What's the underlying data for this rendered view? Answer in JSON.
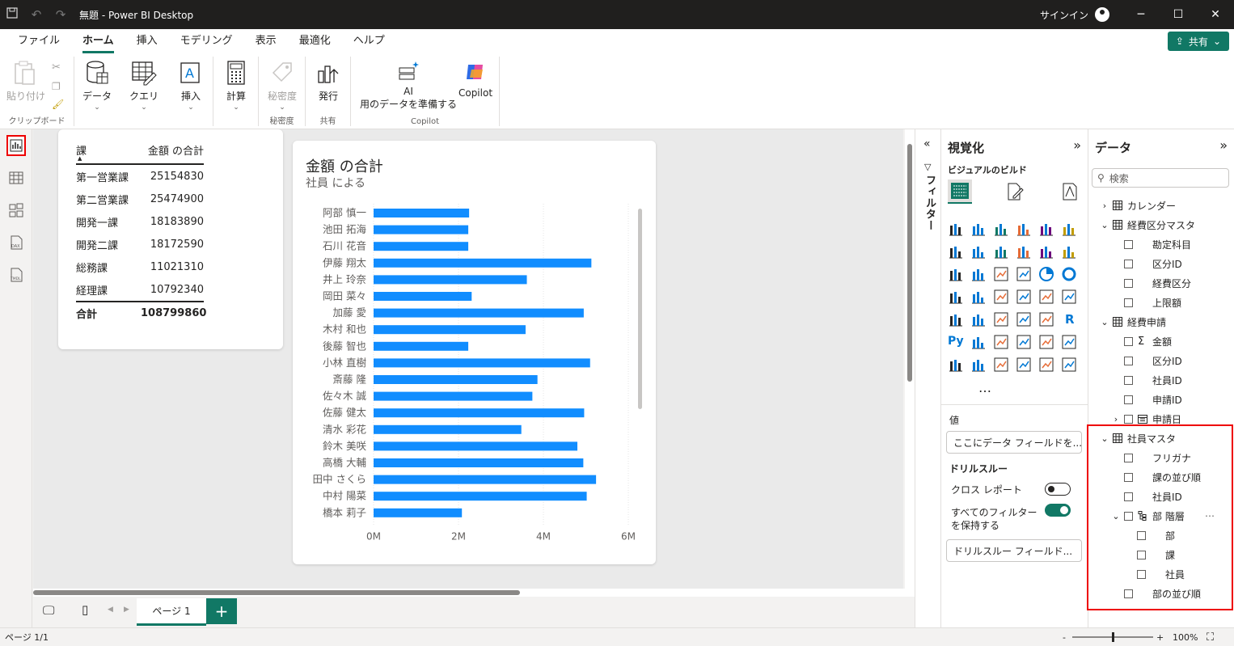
{
  "window": {
    "title": "無題 - Power BI Desktop",
    "signin": "サインイン"
  },
  "menu": [
    "ファイル",
    "ホーム",
    "挿入",
    "モデリング",
    "表示",
    "最適化",
    "ヘルプ"
  ],
  "share_label": "共有",
  "ribbon": {
    "paste": "貼り付け",
    "data": "データ",
    "query": "クエリ",
    "insert": "挿入",
    "calc": "計算",
    "sensitivity": "秘密度",
    "publish": "発行",
    "ai_line1": "AI",
    "ai_line2": "用のデータを準備する",
    "copilot": "Copilot",
    "groups": {
      "clipboard": "クリップボード",
      "sensitivity": "秘密度",
      "share": "共有",
      "copilot": "Copilot"
    }
  },
  "table_visual": {
    "headers": [
      "課",
      "金額 の合計"
    ],
    "rows": [
      [
        "第一営業課",
        "25154830"
      ],
      [
        "第二営業課",
        "25474900"
      ],
      [
        "開発一課",
        "18183890"
      ],
      [
        "開発二課",
        "18172590"
      ],
      [
        "総務課",
        "11021310"
      ],
      [
        "経理課",
        "10792340"
      ]
    ],
    "total": [
      "合計",
      "108799860"
    ]
  },
  "chart_data": {
    "type": "bar",
    "orientation": "horizontal",
    "title": "金額 の合計",
    "subtitle": "社員 による",
    "categories": [
      "阿部 慎一",
      "池田 拓海",
      "石川 花音",
      "伊藤 翔太",
      "井上 玲奈",
      "岡田 菜々",
      "加藤 愛",
      "木村 和也",
      "後藤 智也",
      "小林 直樹",
      "斎藤 隆",
      "佐々木 誠",
      "佐藤 健太",
      "清水 彩花",
      "鈴木 美咲",
      "高橋 大輔",
      "田中 さくら",
      "中村 陽菜",
      "橋本 莉子"
    ],
    "values": [
      2250000,
      2230000,
      2230000,
      5130000,
      3610000,
      2310000,
      4950000,
      3580000,
      2230000,
      5100000,
      3860000,
      3740000,
      4960000,
      3480000,
      4800000,
      4940000,
      5240000,
      5020000,
      2080000
    ],
    "x_ticks": [
      "0M",
      "2M",
      "4M",
      "6M"
    ],
    "xlim": [
      0,
      6000000
    ],
    "color": "#118dff",
    "grid": true
  },
  "filters_label": "フィルター",
  "viz": {
    "title": "視覚化",
    "build": "ビジュアルのビルド",
    "values_label": "値",
    "values_drop": "ここにデータ フィールドを...",
    "drill": "ドリルスルー",
    "cross_report": "クロス レポート",
    "keep_filters": "すべてのフィルター",
    "keep_filters2": "を保持する",
    "drill_drop": "ドリルスルー フィールド...",
    "more": "…",
    "py": "Py",
    "r": "R"
  },
  "data": {
    "title": "データ",
    "search_placeholder": "検索",
    "tree": [
      {
        "label": "カレンダー",
        "kind": "table",
        "level": 0,
        "chev": "›"
      },
      {
        "label": "経費区分マスタ",
        "kind": "table",
        "level": 0,
        "chev": "⌄"
      },
      {
        "label": "勘定科目",
        "kind": "field",
        "level": 1
      },
      {
        "label": "区分ID",
        "kind": "field",
        "level": 1
      },
      {
        "label": "経費区分",
        "kind": "field",
        "level": 1
      },
      {
        "label": "上限額",
        "kind": "field",
        "level": 1
      },
      {
        "label": "経費申請",
        "kind": "table",
        "level": 0,
        "chev": "⌄"
      },
      {
        "label": "金額",
        "kind": "measure",
        "level": 1
      },
      {
        "label": "区分ID",
        "kind": "field",
        "level": 1
      },
      {
        "label": "社員ID",
        "kind": "field",
        "level": 1
      },
      {
        "label": "申請ID",
        "kind": "field",
        "level": 1
      },
      {
        "label": "申請日",
        "kind": "date",
        "level": 1,
        "chev": "›"
      },
      {
        "label": "社員マスタ",
        "kind": "table",
        "level": 0,
        "chev": "⌄"
      },
      {
        "label": "フリガナ",
        "kind": "field",
        "level": 1
      },
      {
        "label": "課の並び順",
        "kind": "field",
        "level": 1
      },
      {
        "label": "社員ID",
        "kind": "field",
        "level": 1
      },
      {
        "label": "部 階層",
        "kind": "hier",
        "level": 1,
        "chev": "⌄"
      },
      {
        "label": "部",
        "kind": "field",
        "level": 2
      },
      {
        "label": "課",
        "kind": "field",
        "level": 2
      },
      {
        "label": "社員",
        "kind": "field",
        "level": 2
      },
      {
        "label": "部の並び順",
        "kind": "field",
        "level": 1
      }
    ]
  },
  "pages": {
    "tab": "ページ 1",
    "add": "+"
  },
  "status": {
    "page": "ページ 1/1",
    "zoom": "100%",
    "minus": "-",
    "plus": "+",
    "zoom_fraction": 0.5
  }
}
